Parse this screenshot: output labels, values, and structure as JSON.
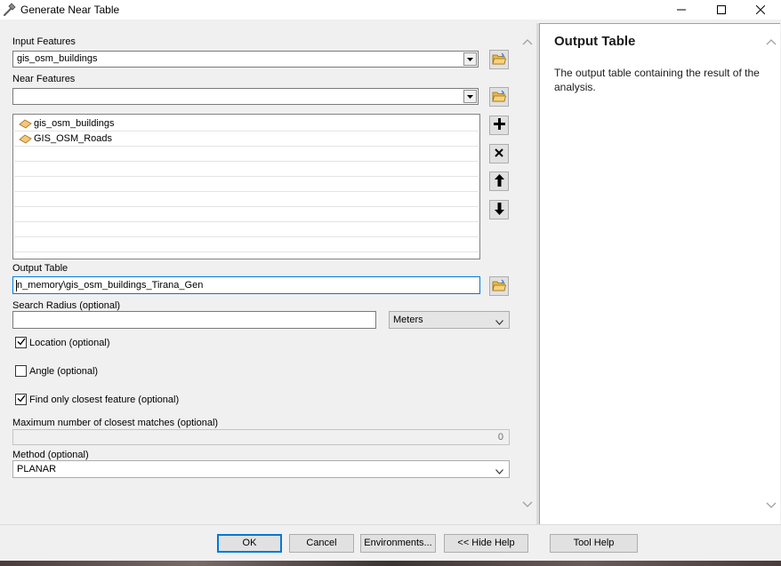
{
  "window": {
    "title": "Generate Near Table",
    "app_icon": "hammer-icon",
    "controls": [
      "minimize-icon",
      "maximize-icon",
      "close-icon"
    ]
  },
  "form": {
    "input_features": {
      "label": "Input Features",
      "value": "gis_osm_buildings"
    },
    "near_features": {
      "label": "Near Features",
      "value": "",
      "items": [
        {
          "label": "gis_osm_buildings",
          "icon": "polygon-layer-icon"
        },
        {
          "label": "GIS_OSM_Roads",
          "icon": "polygon-layer-icon"
        }
      ],
      "buttons": [
        "add-icon",
        "remove-icon",
        "move-up-icon",
        "move-down-icon"
      ]
    },
    "output_table": {
      "label": "Output Table",
      "value": "n_memory\\gis_osm_buildings_Tirana_Gen"
    },
    "search_radius": {
      "label": "Search Radius (optional)",
      "value": "",
      "unit": "Meters"
    },
    "location": {
      "label": "Location (optional)",
      "checked": true
    },
    "angle": {
      "label": "Angle (optional)",
      "checked": false
    },
    "closest": {
      "label": "Find only closest feature (optional)",
      "checked": true
    },
    "max_matches": {
      "label": "Maximum number of closest matches (optional)",
      "value": "0"
    },
    "method": {
      "label": "Method (optional)",
      "value": "PLANAR"
    }
  },
  "help": {
    "title": "Output Table",
    "text": "The output table containing the result of the analysis."
  },
  "buttons": {
    "ok": "OK",
    "cancel": "Cancel",
    "environments": "Environments...",
    "hide_help": "<< Hide Help",
    "tool_help": "Tool Help"
  },
  "colors": {
    "accent": "#0078d7",
    "dialog_bg": "#f0f0f0",
    "folder": "#e8b84a"
  }
}
